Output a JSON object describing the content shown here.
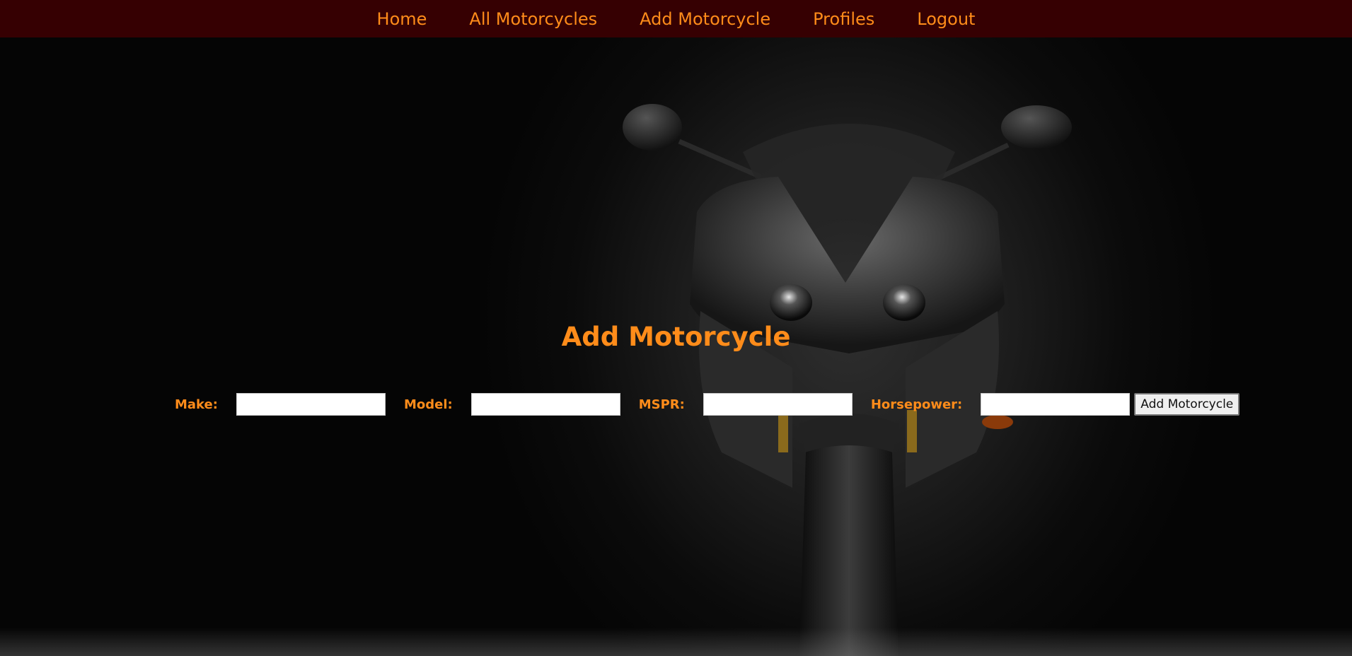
{
  "nav": {
    "items": [
      {
        "label": "Home"
      },
      {
        "label": "All Motorcycles"
      },
      {
        "label": "Add Motorcycle"
      },
      {
        "label": "Profiles"
      },
      {
        "label": "Logout"
      }
    ]
  },
  "main": {
    "title": "Add Motorcycle",
    "form": {
      "make_label": "Make:",
      "make_value": "",
      "model_label": "Model:",
      "model_value": "",
      "mspr_label": "MSPR:",
      "mspr_value": "",
      "horsepower_label": "Horsepower:",
      "horsepower_value": "",
      "submit_label": "Add Motorcycle"
    }
  },
  "colors": {
    "navbar_bg": "#360002",
    "accent": "#ff8c1a",
    "page_bg": "#000000"
  }
}
